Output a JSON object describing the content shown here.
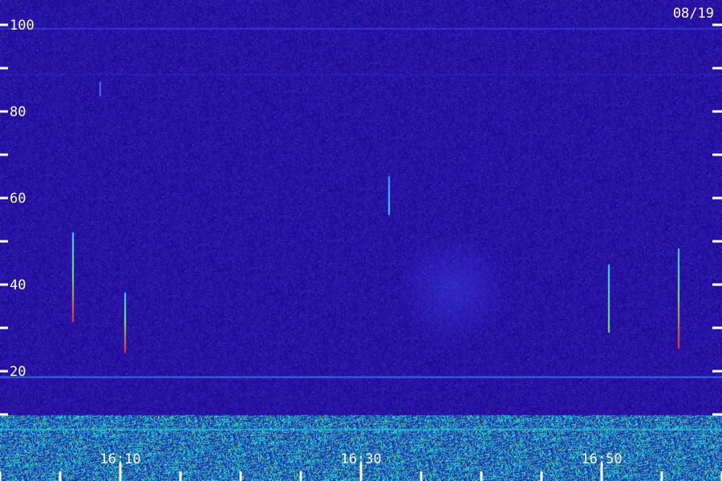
{
  "date_label": "08/19",
  "y_axis": {
    "major_ticks": [
      {
        "value": 100,
        "label": "100"
      },
      {
        "value": 80,
        "label": "80"
      },
      {
        "value": 60,
        "label": "60"
      },
      {
        "value": 40,
        "label": "40"
      },
      {
        "value": 20,
        "label": "20"
      }
    ],
    "minor_ticks": [
      90,
      70,
      50,
      30,
      10
    ],
    "range": [
      0,
      102
    ]
  },
  "x_axis": {
    "time_labels": [
      "16:10",
      "16:30",
      "16:50"
    ],
    "major_tick_minutes": [
      10,
      30,
      50
    ],
    "minor_tick_minutes": [
      0,
      5,
      15,
      20,
      25,
      35,
      40,
      45,
      55,
      60
    ]
  },
  "colors": {
    "background": "#2a0b6b",
    "noise_low": "#150640",
    "noise_high": "#3a2cc8",
    "band_cyan": "#22e6e0",
    "band_green": "#7cf060",
    "streak_red": "#ff2a2a",
    "text": "#ffffff"
  }
}
